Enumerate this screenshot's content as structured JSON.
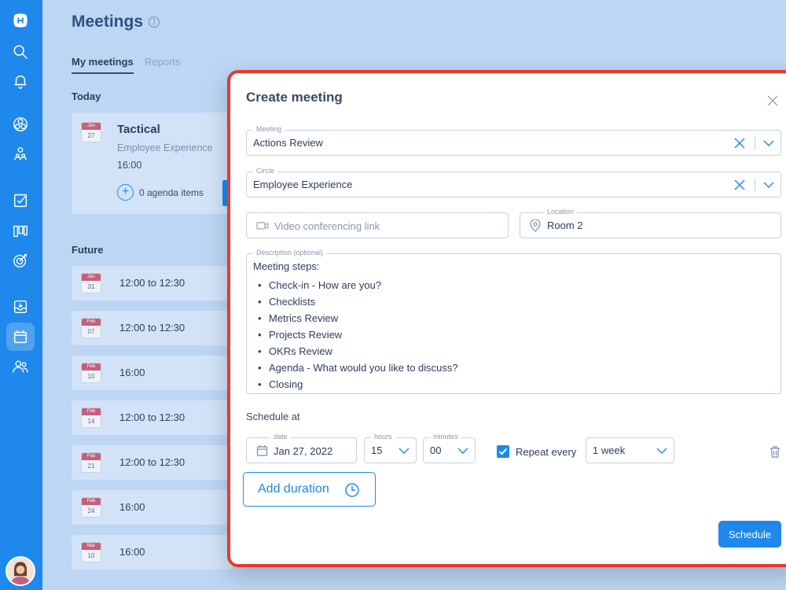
{
  "sidebar": {
    "icons": [
      "logo-icon",
      "search-icon",
      "bell-icon",
      "circles-icon",
      "roles-icon",
      "checklist-icon",
      "board-icon",
      "target-icon",
      "inbox-icon",
      "calendar-icon",
      "people-icon"
    ]
  },
  "page": {
    "title": "Meetings",
    "tabs": {
      "my": "My meetings",
      "reports": "Reports"
    },
    "today_label": "Today",
    "future_label": "Future"
  },
  "today_card": {
    "month": "Jan",
    "day": "27",
    "title": "Tactical",
    "circle": "Employee Experience",
    "time": "16:00",
    "agenda": "0 agenda items"
  },
  "future": [
    {
      "month": "Jan",
      "day": "31",
      "time": "12:00 to 12:30"
    },
    {
      "month": "Feb",
      "day": "07",
      "time": "12:00 to 12:30"
    },
    {
      "month": "Feb",
      "day": "10",
      "time": "16:00"
    },
    {
      "month": "Feb",
      "day": "14",
      "time": "12:00 to 12:30"
    },
    {
      "month": "Feb",
      "day": "21",
      "time": "12:00 to 12:30"
    },
    {
      "month": "Feb",
      "day": "24",
      "time": "16:00"
    },
    {
      "month": "Mar",
      "day": "10",
      "time": "16:00"
    }
  ],
  "modal": {
    "title": "Create meeting",
    "meeting": {
      "legend": "Meeting",
      "value": "Actions Review"
    },
    "circle": {
      "legend": "Circle",
      "value": "Employee Experience"
    },
    "video": {
      "placeholder": "Video conferencing link"
    },
    "location": {
      "legend": "Location",
      "value": "Room 2"
    },
    "description": {
      "legend": "Description (optional)",
      "heading": "Meeting steps:",
      "steps": [
        "Check-in - How are you?",
        "Checklists",
        "Metrics  Review",
        "Projects Review",
        "OKRs Review",
        "Agenda  - What would you like to discuss?",
        "Closing"
      ]
    },
    "schedule_label": "Schedule at",
    "date": {
      "legend": "date",
      "value": "Jan 27, 2022"
    },
    "hours": {
      "legend": "hours",
      "value": "15"
    },
    "minutes": {
      "legend": "minutes",
      "value": "00"
    },
    "repeat_label": "Repeat every",
    "repeat_checked": true,
    "repeat_value": "1 week",
    "add_duration": "Add duration",
    "schedule_button": "Schedule"
  },
  "colors": {
    "accent": "#1e88ec",
    "highlight_border": "#e8392a",
    "calendar_red": "#c6607a"
  }
}
